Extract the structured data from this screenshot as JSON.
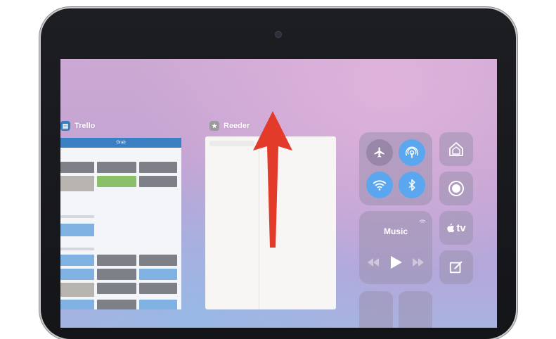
{
  "switcher": {
    "apps": [
      {
        "name": "Trello",
        "icon": "trello-icon",
        "color": "#3a7fc1"
      },
      {
        "name": "Reeder",
        "icon": "reeder-star-icon",
        "color": "#9c9aa0"
      }
    ],
    "trello_board_title": "Grab"
  },
  "control_center": {
    "connectivity": [
      {
        "name": "airplane-mode-toggle",
        "icon": "airplane-icon",
        "active": false
      },
      {
        "name": "airdrop-toggle",
        "icon": "airdrop-icon",
        "active": true
      },
      {
        "name": "wifi-toggle",
        "icon": "wifi-icon",
        "active": true
      },
      {
        "name": "bluetooth-toggle",
        "icon": "bluetooth-icon",
        "active": true
      }
    ],
    "music": {
      "title": "Music",
      "controls": [
        "rewind-icon",
        "play-icon",
        "fast-forward-icon"
      ]
    },
    "side_tiles": [
      {
        "name": "home-tile",
        "icon": "home-icon"
      },
      {
        "name": "screen-record-tile",
        "icon": "record-icon"
      },
      {
        "name": "apple-tv-remote-tile",
        "icon": "apple-tv-icon",
        "label": "tv"
      },
      {
        "name": "notes-tile",
        "icon": "compose-icon"
      }
    ],
    "accent_color": "#5aa7ef"
  },
  "annotation": {
    "arrow_color": "#e33b2a",
    "direction": "up"
  }
}
